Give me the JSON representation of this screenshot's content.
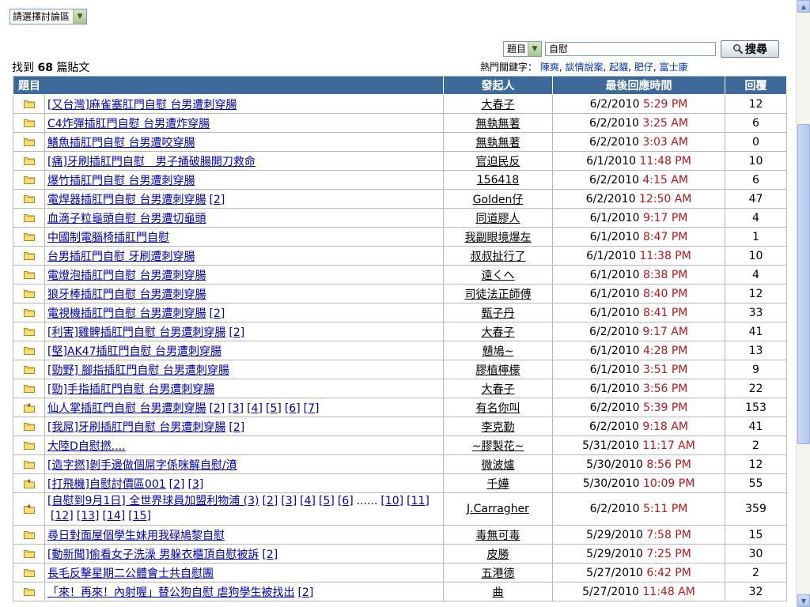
{
  "forum_select": {
    "label": "請選擇討論區"
  },
  "search": {
    "field_label": "題目",
    "query": "自慰",
    "button_label": "搜尋"
  },
  "result_info": {
    "prefix": "找到",
    "count": "68",
    "suffix": "篇貼文"
  },
  "hot_keywords": {
    "label": "熱門關鍵字：",
    "items": [
      "陳爽",
      "談情說案",
      "起貓",
      "肥仔",
      "富士康"
    ]
  },
  "table": {
    "headers": [
      "題目",
      "發起人",
      "最後回應時間",
      "回覆"
    ],
    "rows": [
      {
        "title": "[又台灣]麻雀塞肛門自慰 台男遭刺穿腸",
        "pages": [],
        "author": "大春子",
        "date": "6/2/2010",
        "time": "5:29 PM",
        "replies": "12",
        "icon": "folder"
      },
      {
        "title": "C4炸彈插肛門自慰 台男遭炸穿腸",
        "pages": [],
        "author": "無執無著",
        "date": "6/2/2010",
        "time": "3:25 AM",
        "replies": "6",
        "icon": "folder"
      },
      {
        "title": "鱔魚插肛門自慰 台男遭咬穿腸",
        "pages": [],
        "author": "無執無著",
        "date": "6/2/2010",
        "time": "3:03 AM",
        "replies": "0",
        "icon": "folder"
      },
      {
        "title": "[痛]牙刷插肛門自慰　男子捅破腸開刀救命",
        "pages": [],
        "author": "官迫民反",
        "date": "6/1/2010",
        "time": "11:48 PM",
        "replies": "10",
        "icon": "folder"
      },
      {
        "title": "爆竹插肛門自慰 台男遭刺穿腸",
        "pages": [],
        "author": "156418",
        "date": "6/2/2010",
        "time": "4:15 AM",
        "replies": "6",
        "icon": "folder"
      },
      {
        "title": "電焊器插肛門自慰 台男遭刺穿腸",
        "pages": [
          "[2]"
        ],
        "author": "Golden仔",
        "date": "6/2/2010",
        "time": "12:50 AM",
        "replies": "47",
        "icon": "folder"
      },
      {
        "title": "血滴子粒龜頭自慰 台男遭切龜頭",
        "pages": [],
        "author": "同道膠人",
        "date": "6/1/2010",
        "time": "9:17 PM",
        "replies": "4",
        "icon": "folder"
      },
      {
        "title": "中國制電腦椅插肛門自慰",
        "pages": [],
        "author": "我副眼境爆左",
        "date": "6/1/2010",
        "time": "8:47 PM",
        "replies": "1",
        "icon": "folder"
      },
      {
        "title": "台男插肛門自慰 牙刷遭刺穿腸",
        "pages": [],
        "author": "叔叔扯行了",
        "date": "6/1/2010",
        "time": "11:38 PM",
        "replies": "10",
        "icon": "folder"
      },
      {
        "title": "電燈泡插肛門自慰 台男遭刺穿腸",
        "pages": [],
        "author": "遠くへ",
        "date": "6/1/2010",
        "time": "8:38 PM",
        "replies": "4",
        "icon": "folder"
      },
      {
        "title": "狼牙棒插肛門自慰 台男遭刺穿腸",
        "pages": [],
        "author": "司徒法正師傅",
        "date": "6/1/2010",
        "time": "8:40 PM",
        "replies": "12",
        "icon": "folder"
      },
      {
        "title": "電視機插肛門自慰 台男遭刺穿腸",
        "pages": [
          "[2]"
        ],
        "author": "甄子丹",
        "date": "6/1/2010",
        "time": "8:41 PM",
        "replies": "33",
        "icon": "folder"
      },
      {
        "title": "[利害]雞髀插肛門自慰 台男遭刺穿腸",
        "pages": [
          "[2]"
        ],
        "author": "大春子",
        "date": "6/2/2010",
        "time": "9:17 AM",
        "replies": "41",
        "icon": "folder"
      },
      {
        "title": "[堅]AK47插肛門自慰 台男遭刺穿腸",
        "pages": [],
        "author": "戇鳩~",
        "date": "6/1/2010",
        "time": "4:28 PM",
        "replies": "13",
        "icon": "folder"
      },
      {
        "title": "[勁野] 腳指插肛門自慰 台男遭刺穿腸",
        "pages": [],
        "author": "膠植檸檬",
        "date": "6/1/2010",
        "time": "3:51 PM",
        "replies": "9",
        "icon": "folder"
      },
      {
        "title": "[勁]手指插肛門自慰 台男遭刺穿腸",
        "pages": [],
        "author": "大春子",
        "date": "6/1/2010",
        "time": "3:56 PM",
        "replies": "22",
        "icon": "folder"
      },
      {
        "title": "仙人掌插肛門自慰 台男遭刺穿腸",
        "pages": [
          "[2]",
          "[3]",
          "[4]",
          "[5]",
          "[6]",
          "[7]"
        ],
        "author": "有名你叫",
        "date": "6/2/2010",
        "time": "5:39 PM",
        "replies": "153",
        "icon": "hot"
      },
      {
        "title": "[我屌]牙刷插肛門自慰 台男遭刺穿腸",
        "pages": [
          "[2]"
        ],
        "author": "李克勤",
        "date": "6/2/2010",
        "time": "9:18 AM",
        "replies": "41",
        "icon": "folder"
      },
      {
        "title": "大陸D自慰撚....",
        "pages": [],
        "author": "~膠製花~",
        "date": "5/31/2010",
        "time": "11:17 AM",
        "replies": "2",
        "icon": "folder"
      },
      {
        "title": "[造字撚]剝手邊做個屌字係咪解自慰/濆",
        "pages": [],
        "author": "微波爐",
        "date": "5/30/2010",
        "time": "8:56 PM",
        "replies": "12",
        "icon": "folder"
      },
      {
        "title": "[打飛機]自慰討價區001",
        "pages": [
          "[2]",
          "[3]"
        ],
        "author": "千嬅",
        "date": "5/30/2010",
        "time": "10:09 PM",
        "replies": "55",
        "icon": "hot"
      },
      {
        "title": "[自慰到9月1日] 全世界球員加盟利物浦 (3)",
        "pages": [
          "[2]",
          "[3]",
          "[4]",
          "[5]",
          "[6]",
          "......",
          "[10]",
          "[11]",
          "[12]",
          "[13]",
          "[14]",
          "[15]"
        ],
        "author": "J.Carragher",
        "date": "6/2/2010",
        "time": "5:11 PM",
        "replies": "359",
        "icon": "hot"
      },
      {
        "title": "尋日對面屋個學生妹用我碌鳩黎自慰",
        "pages": [],
        "author": "毒無可毒",
        "date": "5/29/2010",
        "time": "7:58 PM",
        "replies": "15",
        "icon": "folder"
      },
      {
        "title": "[動新聞]偷看女子洗澡 男躲衣櫃頂自慰被訴",
        "pages": [
          "[2]"
        ],
        "author": "皮勝",
        "date": "5/29/2010",
        "time": "7:25 PM",
        "replies": "30",
        "icon": "folder"
      },
      {
        "title": "長毛反擊星期二公體會士共自慰團",
        "pages": [],
        "author": "五港德",
        "date": "5/27/2010",
        "time": "6:42 PM",
        "replies": "2",
        "icon": "folder"
      },
      {
        "title": "「來！再來！內射喔」替公狗自慰 虐狗學生被找出",
        "pages": [
          "[2]"
        ],
        "author": "曲",
        "date": "5/27/2010",
        "time": "11:48 AM",
        "replies": "32",
        "icon": "folder"
      }
    ]
  },
  "colors": {
    "header_bg": "#3d6a98",
    "time_red": "#b1171b",
    "link_blue": "#0000aa"
  }
}
